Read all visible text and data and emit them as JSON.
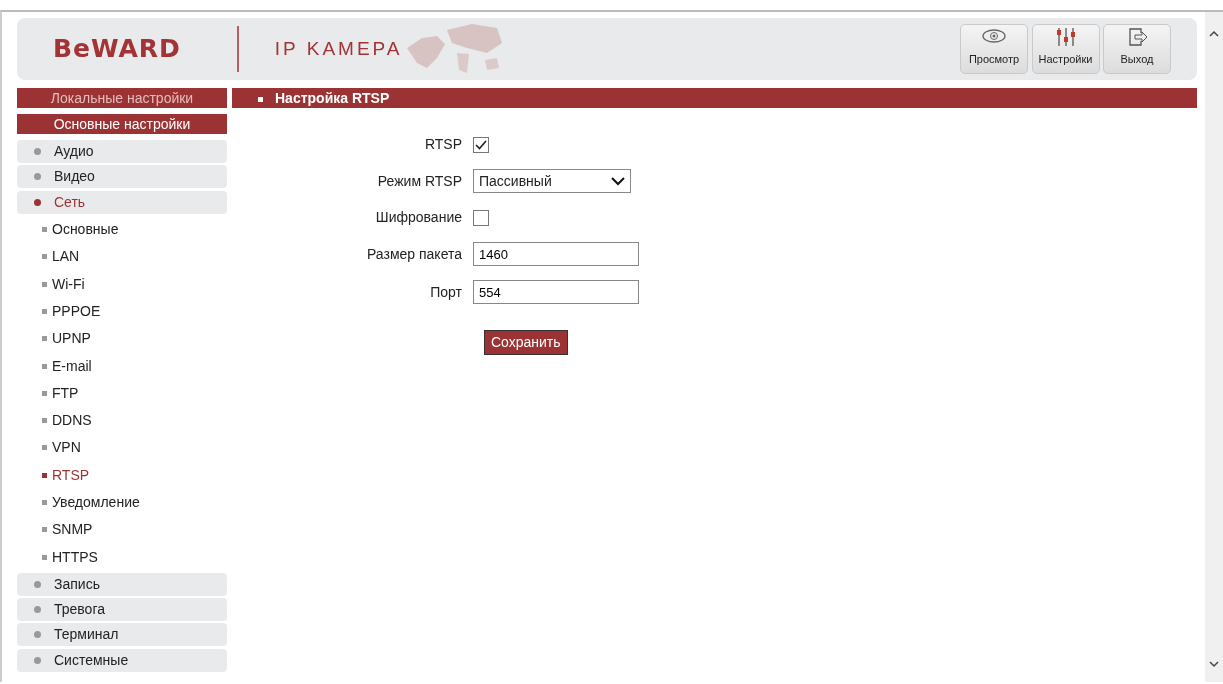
{
  "header": {
    "logo": "BeWARD",
    "subtitle": "IP KAMEPA",
    "buttons": [
      {
        "label": "Просмотр",
        "kind": "eye"
      },
      {
        "label": "Настройки",
        "kind": "sliders"
      },
      {
        "label": "Выход",
        "kind": "exit"
      }
    ]
  },
  "sidebar": {
    "sections": [
      {
        "label": "Локальные настройки",
        "selected": false
      },
      {
        "label": "Основные настройки",
        "selected": true
      }
    ],
    "items": [
      {
        "label": "Аудио",
        "kind": "category",
        "selected": false
      },
      {
        "label": "Видео",
        "kind": "category",
        "selected": false
      },
      {
        "label": "Сеть",
        "kind": "category",
        "selected": true
      },
      {
        "label": "Основные",
        "kind": "subitem",
        "selected": false
      },
      {
        "label": "LAN",
        "kind": "subitem",
        "selected": false
      },
      {
        "label": "Wi-Fi",
        "kind": "subitem",
        "selected": false
      },
      {
        "label": "PPPOE",
        "kind": "subitem",
        "selected": false
      },
      {
        "label": "UPNP",
        "kind": "subitem",
        "selected": false
      },
      {
        "label": "E-mail",
        "kind": "subitem",
        "selected": false
      },
      {
        "label": "FTP",
        "kind": "subitem",
        "selected": false
      },
      {
        "label": "DDNS",
        "kind": "subitem",
        "selected": false
      },
      {
        "label": "VPN",
        "kind": "subitem",
        "selected": false
      },
      {
        "label": "RTSP",
        "kind": "subitem",
        "selected": true
      },
      {
        "label": "Уведомление",
        "kind": "subitem",
        "selected": false
      },
      {
        "label": "SNMP",
        "kind": "subitem",
        "selected": false
      },
      {
        "label": "HTTPS",
        "kind": "subitem",
        "selected": false
      },
      {
        "label": "Запись",
        "kind": "category",
        "selected": false
      },
      {
        "label": "Тревога",
        "kind": "category",
        "selected": false
      },
      {
        "label": "Терминал",
        "kind": "category",
        "selected": false
      },
      {
        "label": "Системные",
        "kind": "category",
        "selected": false
      }
    ]
  },
  "content": {
    "title": "Настройка RTSP",
    "fields": [
      {
        "label": "RTSP",
        "kind": "checkbox",
        "checked": true
      },
      {
        "label": "Режим RTSP",
        "kind": "select",
        "value": "Пассивный"
      },
      {
        "label": "Шифрование",
        "kind": "checkbox",
        "checked": false
      },
      {
        "label": "Размер пакета",
        "kind": "text",
        "value": "1460"
      },
      {
        "label": "Порт",
        "kind": "text",
        "value": "554"
      }
    ],
    "save_button": "Сохранить"
  }
}
